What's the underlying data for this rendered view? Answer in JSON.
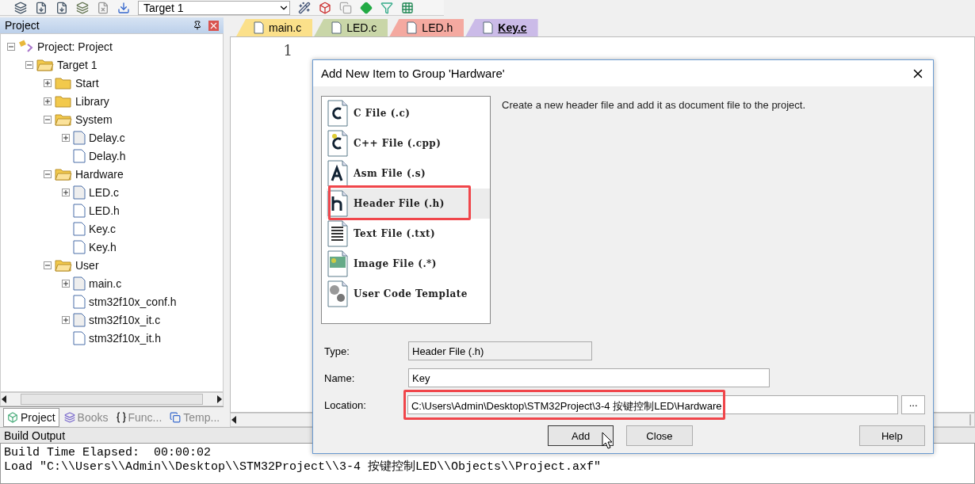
{
  "toolbar": {
    "target": "Target 1"
  },
  "project_panel": {
    "title": "Project",
    "tree": [
      {
        "label": "Project: Project",
        "kind": "project",
        "expanded": true,
        "children": [
          {
            "label": "Target 1",
            "kind": "target",
            "expanded": true,
            "children": [
              {
                "label": "Start",
                "kind": "group",
                "expanded": false
              },
              {
                "label": "Library",
                "kind": "group",
                "expanded": false
              },
              {
                "label": "System",
                "kind": "group",
                "expanded": true,
                "children": [
                  {
                    "label": "Delay.c",
                    "kind": "source",
                    "expanded": false
                  },
                  {
                    "label": "Delay.h",
                    "kind": "header"
                  }
                ]
              },
              {
                "label": "Hardware",
                "kind": "group",
                "expanded": true,
                "children": [
                  {
                    "label": "LED.c",
                    "kind": "source",
                    "expanded": false
                  },
                  {
                    "label": "LED.h",
                    "kind": "header"
                  },
                  {
                    "label": "Key.c",
                    "kind": "header"
                  },
                  {
                    "label": "Key.h",
                    "kind": "header"
                  }
                ]
              },
              {
                "label": "User",
                "kind": "group",
                "expanded": true,
                "children": [
                  {
                    "label": "main.c",
                    "kind": "source",
                    "expanded": false
                  },
                  {
                    "label": "stm32f10x_conf.h",
                    "kind": "header"
                  },
                  {
                    "label": "stm32f10x_it.c",
                    "kind": "source",
                    "expanded": false
                  },
                  {
                    "label": "stm32f10x_it.h",
                    "kind": "header"
                  }
                ]
              }
            ]
          }
        ]
      }
    ],
    "tabs": [
      {
        "label": "Project",
        "kind": "project",
        "selected": true
      },
      {
        "label": "Books",
        "kind": "books",
        "selected": false
      },
      {
        "label": "Func...",
        "kind": "func",
        "selected": false
      },
      {
        "label": "Temp...",
        "kind": "temp",
        "selected": false
      }
    ]
  },
  "editor": {
    "tabs": [
      {
        "label": "main.c",
        "color": "#fbe08a",
        "selected": false
      },
      {
        "label": "LED.c",
        "color": "#c9d6a8",
        "selected": false
      },
      {
        "label": "LED.h",
        "color": "#f4a9a0",
        "selected": false
      },
      {
        "label": "Key.c",
        "color": "#cbbbe8",
        "selected": true
      }
    ],
    "line_numbers": [
      "1"
    ]
  },
  "build_output": {
    "title": "Build Output",
    "lines": [
      "Build Time Elapsed:  00:00:02",
      "Load \"C:\\\\Users\\\\Admin\\\\Desktop\\\\STM32Project\\\\3-4 按键控制LED\\\\Objects\\\\Project.axf\""
    ]
  },
  "dialog": {
    "title": "Add New Item to Group 'Hardware'",
    "items": [
      {
        "label": "C File (.c)",
        "kind": "c",
        "selected": false,
        "highlighted": false
      },
      {
        "label": "C++ File (.cpp)",
        "kind": "cpp",
        "selected": false,
        "highlighted": false
      },
      {
        "label": "Asm File (.s)",
        "kind": "asm",
        "selected": false,
        "highlighted": false
      },
      {
        "label": "Header File (.h)",
        "kind": "h",
        "selected": true,
        "highlighted": true
      },
      {
        "label": "Text File (.txt)",
        "kind": "txt",
        "selected": false,
        "highlighted": false
      },
      {
        "label": "Image File (.*)",
        "kind": "image",
        "selected": false,
        "highlighted": false
      },
      {
        "label": "User Code Template",
        "kind": "template",
        "selected": false,
        "highlighted": false
      }
    ],
    "description": "Create a new header file and add it as document file to the project.",
    "fields": [
      {
        "label": "Type:",
        "value": "Header File (.h)",
        "kind": "readonly",
        "highlighted": false
      },
      {
        "label": "Name:",
        "value": "Key",
        "kind": "text",
        "highlighted": false
      },
      {
        "label": "Location:",
        "value": "C:\\Users\\Admin\\Desktop\\STM32Project\\3-4 按键控制LED\\Hardware",
        "kind": "path",
        "browse": "...",
        "highlighted": true
      }
    ],
    "buttons": [
      {
        "label": "Add",
        "kind": "add"
      },
      {
        "label": "Close",
        "kind": "close"
      },
      {
        "label": "Help",
        "kind": "help"
      }
    ]
  }
}
